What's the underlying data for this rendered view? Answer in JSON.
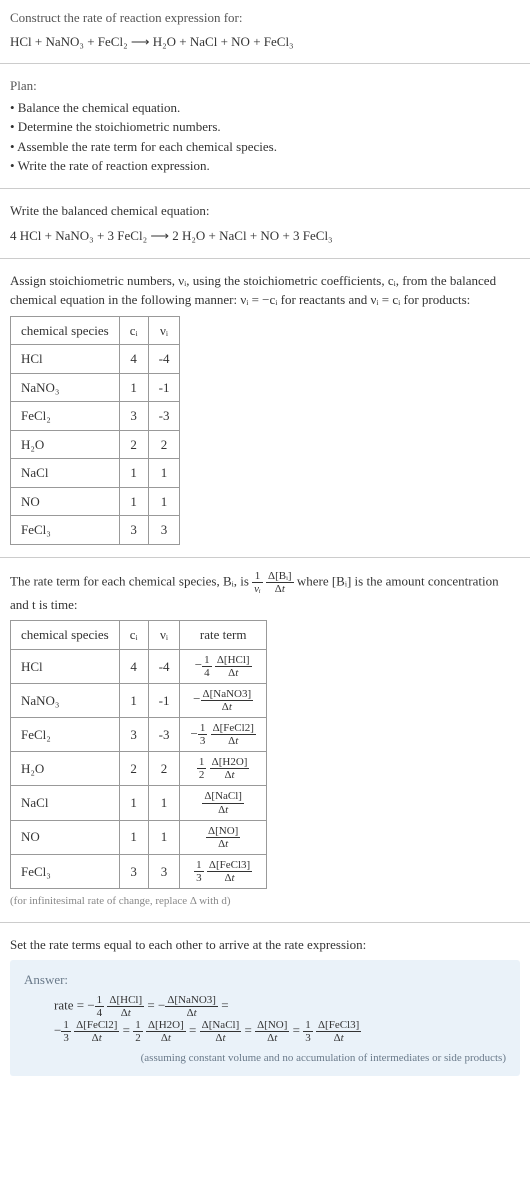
{
  "prompt": {
    "line1": "Construct the rate of reaction expression for:",
    "equation": "HCl + NaNO₃ + FeCl₂ ⟶ H₂O + NaCl + NO + FeCl₃"
  },
  "plan": {
    "title": "Plan:",
    "items": [
      "• Balance the chemical equation.",
      "• Determine the stoichiometric numbers.",
      "• Assemble the rate term for each chemical species.",
      "• Write the rate of reaction expression."
    ]
  },
  "balanced": {
    "title": "Write the balanced chemical equation:",
    "equation": "4 HCl + NaNO₃ + 3 FeCl₂ ⟶ 2 H₂O + NaCl + NO + 3 FeCl₃"
  },
  "assign": {
    "text": "Assign stoichiometric numbers, νᵢ, using the stoichiometric coefficients, cᵢ, from the balanced chemical equation in the following manner: νᵢ = −cᵢ for reactants and νᵢ = cᵢ for products:"
  },
  "table1": {
    "headers": [
      "chemical species",
      "cᵢ",
      "νᵢ"
    ],
    "rows": [
      {
        "species": "HCl",
        "c": "4",
        "nu": "-4"
      },
      {
        "species": "NaNO₃",
        "c": "1",
        "nu": "-1"
      },
      {
        "species": "FeCl₂",
        "c": "3",
        "nu": "-3"
      },
      {
        "species": "H₂O",
        "c": "2",
        "nu": "2"
      },
      {
        "species": "NaCl",
        "c": "1",
        "nu": "1"
      },
      {
        "species": "NO",
        "c": "1",
        "nu": "1"
      },
      {
        "species": "FeCl₃",
        "c": "3",
        "nu": "3"
      }
    ]
  },
  "rate_term_intro": {
    "pre": "The rate term for each chemical species, Bᵢ, is ",
    "post": " where [Bᵢ] is the amount concentration and t is time:"
  },
  "table2": {
    "headers": [
      "chemical species",
      "cᵢ",
      "νᵢ",
      "rate term"
    ],
    "rows": [
      {
        "species": "HCl",
        "c": "4",
        "nu": "-4",
        "sign": "−",
        "coef_num": "1",
        "coef_den": "4",
        "delta": "Δ[HCl]"
      },
      {
        "species": "NaNO₃",
        "c": "1",
        "nu": "-1",
        "sign": "−",
        "coef_num": "",
        "coef_den": "",
        "delta": "Δ[NaNO3]"
      },
      {
        "species": "FeCl₂",
        "c": "3",
        "nu": "-3",
        "sign": "−",
        "coef_num": "1",
        "coef_den": "3",
        "delta": "Δ[FeCl2]"
      },
      {
        "species": "H₂O",
        "c": "2",
        "nu": "2",
        "sign": "",
        "coef_num": "1",
        "coef_den": "2",
        "delta": "Δ[H2O]"
      },
      {
        "species": "NaCl",
        "c": "1",
        "nu": "1",
        "sign": "",
        "coef_num": "",
        "coef_den": "",
        "delta": "Δ[NaCl]"
      },
      {
        "species": "NO",
        "c": "1",
        "nu": "1",
        "sign": "",
        "coef_num": "",
        "coef_den": "",
        "delta": "Δ[NO]"
      },
      {
        "species": "FeCl₃",
        "c": "3",
        "nu": "3",
        "sign": "",
        "coef_num": "1",
        "coef_den": "3",
        "delta": "Δ[FeCl3]"
      }
    ]
  },
  "footnote": "(for infinitesimal rate of change, replace Δ with d)",
  "set_equal": "Set the rate terms equal to each other to arrive at the rate expression:",
  "answer": {
    "label": "Answer:",
    "note": "(assuming constant volume and no accumulation of intermediates or side products)"
  },
  "chart_data": {
    "type": "table",
    "title": "Stoichiometric numbers and rate terms",
    "tables": [
      {
        "columns": [
          "chemical species",
          "c_i",
          "nu_i"
        ],
        "rows": [
          [
            "HCl",
            4,
            -4
          ],
          [
            "NaNO3",
            1,
            -1
          ],
          [
            "FeCl2",
            3,
            -3
          ],
          [
            "H2O",
            2,
            2
          ],
          [
            "NaCl",
            1,
            1
          ],
          [
            "NO",
            1,
            1
          ],
          [
            "FeCl3",
            3,
            3
          ]
        ]
      },
      {
        "columns": [
          "chemical species",
          "c_i",
          "nu_i",
          "rate term"
        ],
        "rows": [
          [
            "HCl",
            4,
            -4,
            "-(1/4) Δ[HCl]/Δt"
          ],
          [
            "NaNO3",
            1,
            -1,
            "-Δ[NaNO3]/Δt"
          ],
          [
            "FeCl2",
            3,
            -3,
            "-(1/3) Δ[FeCl2]/Δt"
          ],
          [
            "H2O",
            2,
            2,
            "(1/2) Δ[H2O]/Δt"
          ],
          [
            "NaCl",
            1,
            1,
            "Δ[NaCl]/Δt"
          ],
          [
            "NO",
            1,
            1,
            "Δ[NO]/Δt"
          ],
          [
            "FeCl3",
            3,
            3,
            "(1/3) Δ[FeCl3]/Δt"
          ]
        ]
      }
    ],
    "rate_expression": "rate = -(1/4) Δ[HCl]/Δt = -Δ[NaNO3]/Δt = -(1/3) Δ[FeCl2]/Δt = (1/2) Δ[H2O]/Δt = Δ[NaCl]/Δt = Δ[NO]/Δt = (1/3) Δ[FeCl3]/Δt"
  }
}
